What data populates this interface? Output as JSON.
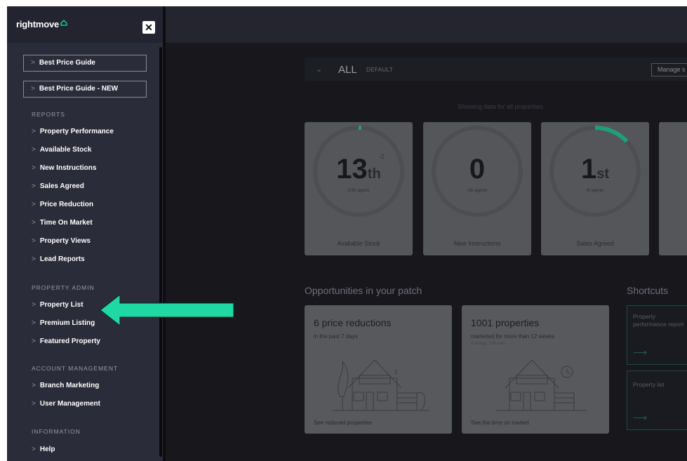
{
  "sidebar": {
    "logo": "rightmove",
    "close": "✕",
    "buttons": [
      {
        "label": "Best Price Guide"
      },
      {
        "label": "Best Price Guide - NEW"
      }
    ],
    "sections": {
      "reports": "REPORTS",
      "property_admin": "PROPERTY ADMIN",
      "account_management": "ACCOUNT MANAGEMENT",
      "information": "INFORMATION"
    },
    "chevron": ">",
    "reports_items": [
      {
        "label": "Property Performance"
      },
      {
        "label": "Available Stock"
      },
      {
        "label": "New Instructions"
      },
      {
        "label": "Sales Agreed"
      },
      {
        "label": "Price Reduction"
      },
      {
        "label": "Time On Market"
      },
      {
        "label": "Property Views"
      },
      {
        "label": "Lead Reports"
      }
    ],
    "admin_items": [
      {
        "label": "Property List"
      },
      {
        "label": "Premium Listing"
      },
      {
        "label": "Featured Property"
      }
    ],
    "account_items": [
      {
        "label": "Branch Marketing"
      },
      {
        "label": "User Management"
      }
    ],
    "info_items": [
      {
        "label": "Help"
      }
    ]
  },
  "filter": {
    "chevron": "⌄",
    "selected": "ALL",
    "tag": "DEFAULT",
    "manage_label": "Manage s"
  },
  "showing_text": "Showing data for all properties.",
  "stat_cards": [
    {
      "value": "13",
      "suffix": "th",
      "sub": "/228 agents",
      "delta": "-2",
      "label": "Available Stock",
      "ring_fraction": 0.01
    },
    {
      "value": "0",
      "suffix": "",
      "sub": "/16 agents",
      "delta": "",
      "label": "New Instructions",
      "ring_fraction": 0
    },
    {
      "value": "1",
      "suffix": "st",
      "sub": "/8 agents",
      "delta": "",
      "label": "Sales Agreed",
      "ring_fraction": 0.13
    }
  ],
  "opportunities": {
    "heading": "Opportunities in your patch",
    "cards": [
      {
        "title": "6 price reductions",
        "sub": "in the past 7 days",
        "sub2": "",
        "link": "See reduced properties"
      },
      {
        "title": "1001 properties",
        "sub": "marketed for more than 12 weeks",
        "sub2": "Average: 226 days",
        "link": "See the time on market"
      }
    ]
  },
  "shortcuts": {
    "heading": "Shortcuts",
    "items": [
      {
        "label": "Property performance report",
        "arrow": "⟶"
      },
      {
        "label": "Property list",
        "arrow": "⟶"
      }
    ]
  },
  "colors": {
    "accent_green": "#1fd8a4",
    "sidebar_bg": "#2b2c3a",
    "main_bg": "#17171c"
  }
}
